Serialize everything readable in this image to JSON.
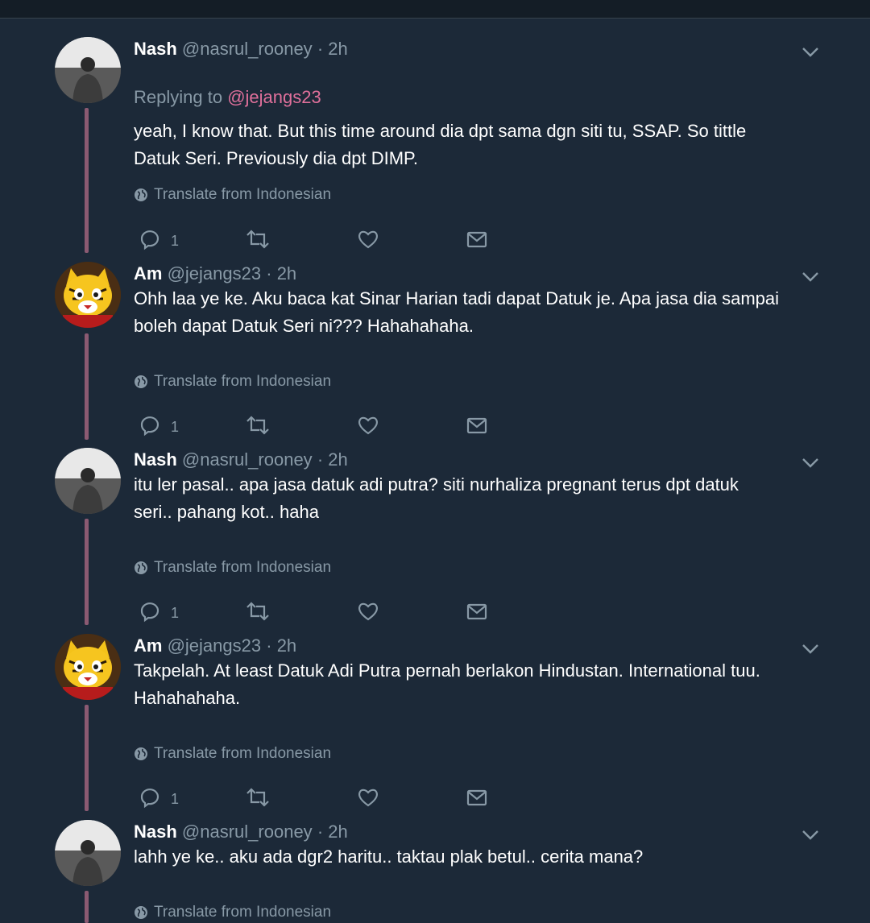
{
  "translate_label": "Translate from Indonesian",
  "tweets": [
    {
      "name": "Nash",
      "handle": "@nasrul_rooney",
      "sep": "·",
      "time": "2h",
      "replying_prefix": "Replying to ",
      "replying_handle": "@jejangs23",
      "text_lines": [
        "yeah, I know that. But this time around dia dpt sama dgn siti tu, SSAP. So tittle",
        "Datuk Seri. Previously dia dpt DIMP."
      ],
      "reply_count": "1"
    },
    {
      "name": "Am",
      "handle": "@jejangs23",
      "sep": "·",
      "time": "2h",
      "text_lines": [
        "Ohh laa ye ke. Aku baca kat Sinar Harian tadi dapat Datuk je. Apa jasa dia sampai",
        "boleh dapat Datuk Seri ni??? Hahahahaha."
      ],
      "reply_count": "1"
    },
    {
      "name": "Nash",
      "handle": "@nasrul_rooney",
      "sep": "·",
      "time": "2h",
      "text_lines": [
        "itu ler pasal.. apa jasa datuk adi putra? siti nurhaliza pregnant terus dpt datuk",
        "seri.. pahang kot.. haha"
      ],
      "reply_count": "1"
    },
    {
      "name": "Am",
      "handle": "@jejangs23",
      "sep": "·",
      "time": "2h",
      "text_lines": [
        "Takpelah. At least Datuk Adi Putra pernah berlakon Hindustan. International tuu.",
        "Hahahahaha."
      ],
      "reply_count": "1"
    },
    {
      "name": "Nash",
      "handle": "@nasrul_rooney",
      "sep": "·",
      "time": "2h",
      "text_lines": [
        "lahh ye ke.. aku ada dgr2 haritu.. taktau plak betul.. cerita mana?"
      ],
      "reply_count": ""
    }
  ]
}
